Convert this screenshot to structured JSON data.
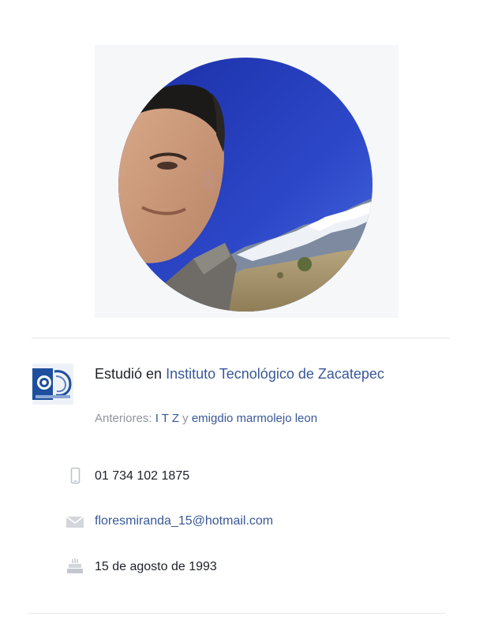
{
  "profile": {
    "photo_icon": "profile-photo"
  },
  "education": {
    "logo_icon": "school-logo",
    "prefix": "Estudió en ",
    "school": "Instituto Tecnológico de Zacatepec",
    "previous_label": "Anteriores: ",
    "previous_1": "I T Z",
    "previous_separator": " y ",
    "previous_2": "emigdio marmolejo leon"
  },
  "contact": {
    "phone_icon": "phone-icon",
    "phone": "01 734 102 1875",
    "email_icon": "mail-icon",
    "email": "floresmiranda_15@hotmail.com",
    "birthday_icon": "cake-icon",
    "birthday": "15 de agosto de 1993"
  },
  "colors": {
    "link": "#385898",
    "secondary": "#90949c",
    "text": "#1d2129",
    "icon": "#bec3c9"
  }
}
